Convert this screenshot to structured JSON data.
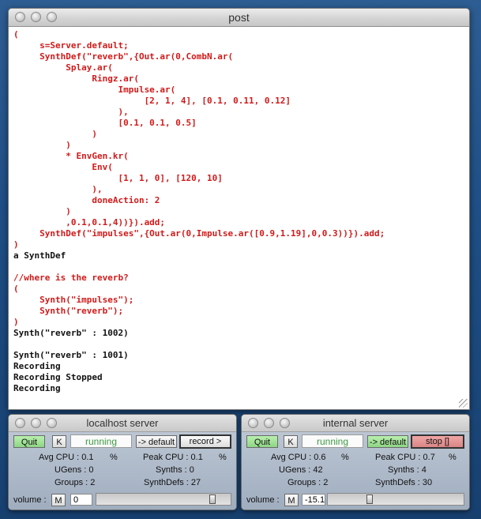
{
  "post_window": {
    "title": "post",
    "lines": [
      {
        "text": "(",
        "color": "red"
      },
      {
        "text": "     s=Server.default;",
        "color": "red"
      },
      {
        "text": "     SynthDef(\"reverb\",{Out.ar(0,CombN.ar(",
        "color": "red"
      },
      {
        "text": "          Splay.ar(",
        "color": "red"
      },
      {
        "text": "               Ringz.ar(",
        "color": "red"
      },
      {
        "text": "                    Impulse.ar(",
        "color": "red"
      },
      {
        "text": "                         [2, 1, 4], [0.1, 0.11, 0.12]",
        "color": "red"
      },
      {
        "text": "                    ),",
        "color": "red"
      },
      {
        "text": "                    [0.1, 0.1, 0.5]",
        "color": "red"
      },
      {
        "text": "               )",
        "color": "red"
      },
      {
        "text": "          )",
        "color": "red"
      },
      {
        "text": "          * EnvGen.kr(",
        "color": "red"
      },
      {
        "text": "               Env(",
        "color": "red"
      },
      {
        "text": "                    [1, 1, 0], [120, 10]",
        "color": "red"
      },
      {
        "text": "               ),",
        "color": "red"
      },
      {
        "text": "               doneAction: 2",
        "color": "red"
      },
      {
        "text": "          )",
        "color": "red"
      },
      {
        "text": "          ,0.1,0.1,4))}).add;",
        "color": "red"
      },
      {
        "text": "     SynthDef(\"impulses\",{Out.ar(0,Impulse.ar([0.9,1.19],0,0.3))}).add;",
        "color": "red"
      },
      {
        "text": ")",
        "color": "red"
      },
      {
        "text": "a SynthDef",
        "color": "black"
      },
      {
        "text": "",
        "color": "black"
      },
      {
        "text": "//where is the reverb?",
        "color": "red"
      },
      {
        "text": "(",
        "color": "red"
      },
      {
        "text": "     Synth(\"impulses\");",
        "color": "red"
      },
      {
        "text": "     Synth(\"reverb\");",
        "color": "red"
      },
      {
        "text": ")",
        "color": "red"
      },
      {
        "text": "Synth(\"reverb\" : 1002)",
        "color": "black"
      },
      {
        "text": "",
        "color": "black"
      },
      {
        "text": "Synth(\"reverb\" : 1001)",
        "color": "black"
      },
      {
        "text": "Recording",
        "color": "black"
      },
      {
        "text": "Recording Stopped",
        "color": "black"
      },
      {
        "text": "Recording",
        "color": "black"
      }
    ]
  },
  "localhost": {
    "title": "localhost server",
    "quit": "Quit",
    "k": "K",
    "status": "running",
    "default_btn": "-> default",
    "record_btn": "record >",
    "avg_cpu_label": "Avg CPU : 0.1",
    "avg_cpu_unit": "%",
    "peak_cpu_label": "Peak CPU : 0.1",
    "peak_cpu_unit": "%",
    "ugens": "UGens : 0",
    "synths": "Synths : 0",
    "groups": "Groups : 2",
    "synthdefs": "SynthDefs : 27",
    "volume_label": "volume :",
    "m": "M",
    "volume_value": "0",
    "volume_level": 0.88
  },
  "internal": {
    "title": "internal server",
    "quit": "Quit",
    "k": "K",
    "status": "running",
    "default_btn": "-> default",
    "stop_btn": "stop []",
    "avg_cpu_label": "Avg CPU : 0.6",
    "avg_cpu_unit": "%",
    "peak_cpu_label": "Peak CPU : 0.7",
    "peak_cpu_unit": "%",
    "ugens": "UGens : 42",
    "synths": "Synths : 4",
    "groups": "Groups : 2",
    "synthdefs": "SynthDefs : 30",
    "volume_label": "volume :",
    "m": "M",
    "volume_value": "-15.1",
    "volume_level": 0.3
  },
  "colors": {
    "code_red": "#d11a1a",
    "code_black": "#111111",
    "running_green": "#3e9a44",
    "quit_green": "#a3e598",
    "stop_red": "#e39595"
  }
}
